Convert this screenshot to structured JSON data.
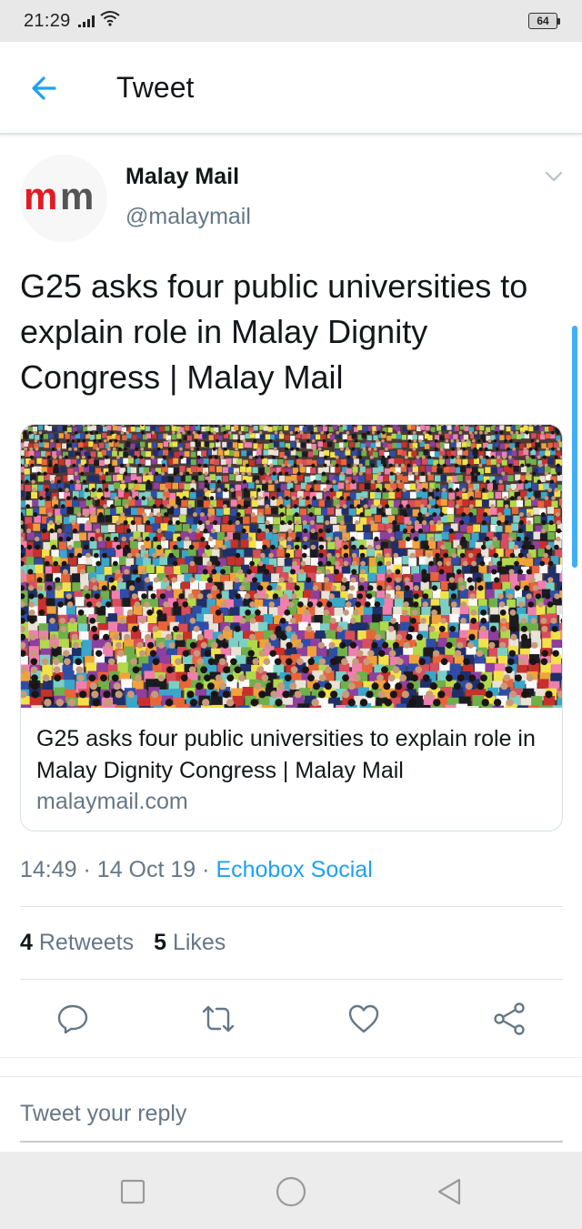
{
  "status_bar": {
    "time": "21:29",
    "battery": "64",
    "icons": [
      "signal-icon",
      "wifi-icon",
      "battery-icon"
    ]
  },
  "header": {
    "title": "Tweet",
    "back_icon": "arrow-left-icon"
  },
  "tweet": {
    "author_name": "Malay Mail",
    "author_handle": "@malaymail",
    "avatar_logo_text": "mm",
    "text": "G25 asks four public universities to explain role in Malay Dignity Congress | Malay Mail",
    "card": {
      "image_description_icon": "photo-crowd",
      "title": "G25 asks four public universities to explain role in Malay Dignity Congress | Malay Mail",
      "domain": "malaymail.com"
    },
    "time": "14:49",
    "date": "14 Oct 19",
    "separator": "·",
    "source": "Echobox Social",
    "retweets_count": "4",
    "retweets_label": "Retweets",
    "likes_count": "5",
    "likes_label": "Likes"
  },
  "actions": [
    "reply-icon",
    "retweet-icon",
    "like-icon",
    "share-icon"
  ],
  "reply": {
    "placeholder": "Tweet your reply"
  },
  "nav": [
    "recent-apps-icon",
    "home-icon",
    "back-icon"
  ],
  "colors": {
    "accent": "#1da1f2",
    "secondary_text": "#657786",
    "logo_red": "#e11b22",
    "logo_gray": "#555555"
  }
}
